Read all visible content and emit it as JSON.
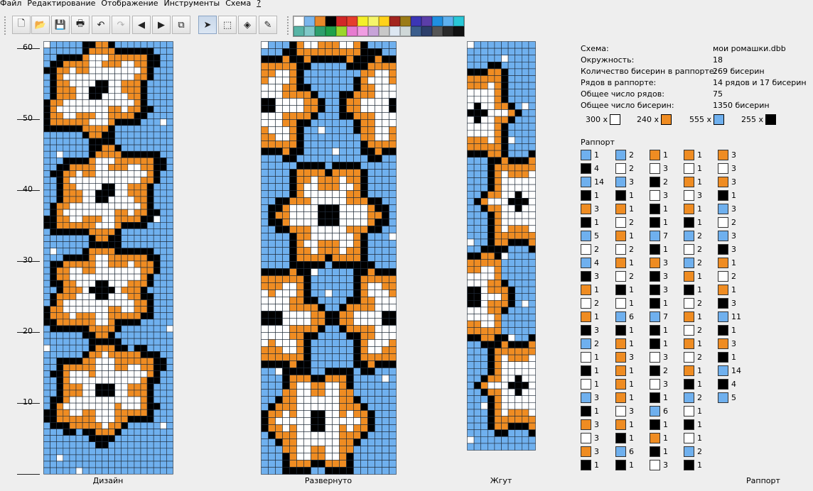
{
  "menu": [
    "Файл",
    "Редактирование",
    "Отображение",
    "Инструменты",
    "Схема",
    "?"
  ],
  "toolbar": {
    "buttons": [
      {
        "name": "new-file-button",
        "glyph": "🗋",
        "state": "normal"
      },
      {
        "name": "open-file-button",
        "glyph": "📂",
        "state": "normal"
      },
      {
        "name": "save-button",
        "glyph": "💾",
        "state": "normal"
      },
      {
        "name": "print-button",
        "glyph": "🖶",
        "state": "normal"
      },
      {
        "name": "undo-button",
        "glyph": "↶",
        "state": "normal"
      },
      {
        "name": "redo-button",
        "glyph": "↷",
        "state": "disabled"
      },
      {
        "name": "shift-left-button",
        "glyph": "◀",
        "state": "normal"
      },
      {
        "name": "shift-right-button",
        "glyph": "▶",
        "state": "normal"
      },
      {
        "name": "copy-button",
        "glyph": "⧉",
        "state": "normal"
      },
      {
        "name": "pointer-tool-button",
        "glyph": "➤",
        "state": "pressed"
      },
      {
        "name": "select-tool-button",
        "glyph": "⬚",
        "state": "normal"
      },
      {
        "name": "fill-tool-button",
        "glyph": "◈",
        "state": "normal"
      },
      {
        "name": "eyedropper-tool-button",
        "glyph": "✎",
        "state": "normal"
      }
    ],
    "palette_colors": [
      "#ffffff",
      "#7bb6ec",
      "#e8882a",
      "#000000",
      "#d12727",
      "#e53d2c",
      "#f4ef2a",
      "#f5f56a",
      "#ffd21a",
      "#a2251f",
      "#9b7b16",
      "#3c36b5",
      "#5b3ea8",
      "#1f8fe0",
      "#5eb1ef",
      "#29c7d7",
      "#58b4a6",
      "#7fc8c8",
      "#2e9f6d",
      "#1ea14b",
      "#9bd62c",
      "#e67ad0",
      "#f09ce2",
      "#c7a3d8",
      "#c8c8c8",
      "#dde7f2",
      "#cfd8d8",
      "#3a5d8c",
      "#2c3f6b",
      "#555555",
      "#2a2a2a",
      "#111111"
    ]
  },
  "ruler_labels": [
    "60",
    "50",
    "40",
    "30",
    "20",
    "10"
  ],
  "bead_colors": {
    "blue": "#6fb0ee",
    "orange": "#ef8c22",
    "white": "#ffffff",
    "black": "#000000"
  },
  "views": {
    "design_caption": "Дизайн",
    "unrolled_caption": "Развернуто",
    "rope_caption": "Жгут",
    "rapport_caption": "Раппорт"
  },
  "info": [
    {
      "label": "Схема:",
      "value": "мои ромашки.dbb"
    },
    {
      "label": "Окружность:",
      "value": "18"
    },
    {
      "label": "Количество бисерин в раппорте:",
      "value": "269 бисерин"
    },
    {
      "label": "Рядов в раппорте:",
      "value": "14 рядов и 17 бисерин"
    },
    {
      "label": "Общее число рядов:",
      "value": "75"
    },
    {
      "label": "Общее число бисерин:",
      "value": "1350 бисерин"
    }
  ],
  "counts": [
    {
      "text": "300 x",
      "color": "#ffffff"
    },
    {
      "text": "240 x",
      "color": "#ef8c22"
    },
    {
      "text": "555 x",
      "color": "#6fb0ee"
    },
    {
      "text": "255 x",
      "color": "#000000"
    }
  ],
  "rapport_title": "Раппорт",
  "rapport_columns": [
    [
      [
        "blue",
        "1"
      ],
      [
        "black",
        "4"
      ],
      [
        "blue",
        "14"
      ],
      [
        "black",
        "1"
      ],
      [
        "orange",
        "3"
      ],
      [
        "black",
        "1"
      ],
      [
        "blue",
        "5"
      ],
      [
        "white",
        "2"
      ],
      [
        "blue",
        "4"
      ],
      [
        "black",
        "3"
      ],
      [
        "orange",
        "1"
      ],
      [
        "white",
        "2"
      ],
      [
        "orange",
        "1"
      ],
      [
        "black",
        "3"
      ],
      [
        "blue",
        "2"
      ],
      [
        "white",
        "1"
      ],
      [
        "black",
        "1"
      ],
      [
        "white",
        "1"
      ],
      [
        "blue",
        "3"
      ],
      [
        "black",
        "1"
      ],
      [
        "orange",
        "3"
      ],
      [
        "white",
        "3"
      ],
      [
        "orange",
        "3"
      ],
      [
        "black",
        "1"
      ]
    ],
    [
      [
        "blue",
        "2"
      ],
      [
        "white",
        "2"
      ],
      [
        "blue",
        "3"
      ],
      [
        "black",
        "1"
      ],
      [
        "orange",
        "1"
      ],
      [
        "white",
        "2"
      ],
      [
        "orange",
        "1"
      ],
      [
        "white",
        "2"
      ],
      [
        "orange",
        "1"
      ],
      [
        "white",
        "2"
      ],
      [
        "black",
        "1"
      ],
      [
        "white",
        "1"
      ],
      [
        "blue",
        "6"
      ],
      [
        "black",
        "1"
      ],
      [
        "orange",
        "1"
      ],
      [
        "orange",
        "3"
      ],
      [
        "orange",
        "1"
      ],
      [
        "orange",
        "1"
      ],
      [
        "orange",
        "1"
      ],
      [
        "white",
        "3"
      ],
      [
        "orange",
        "1"
      ],
      [
        "black",
        "1"
      ],
      [
        "blue",
        "6"
      ],
      [
        "black",
        "1"
      ]
    ],
    [
      [
        "orange",
        "1"
      ],
      [
        "white",
        "3"
      ],
      [
        "black",
        "2"
      ],
      [
        "white",
        "3"
      ],
      [
        "black",
        "1"
      ],
      [
        "black",
        "1"
      ],
      [
        "blue",
        "7"
      ],
      [
        "black",
        "1"
      ],
      [
        "orange",
        "3"
      ],
      [
        "black",
        "3"
      ],
      [
        "black",
        "3"
      ],
      [
        "black",
        "1"
      ],
      [
        "blue",
        "7"
      ],
      [
        "black",
        "1"
      ],
      [
        "black",
        "1"
      ],
      [
        "white",
        "3"
      ],
      [
        "black",
        "2"
      ],
      [
        "white",
        "3"
      ],
      [
        "black",
        "1"
      ],
      [
        "blue",
        "6"
      ],
      [
        "black",
        "1"
      ],
      [
        "orange",
        "1"
      ],
      [
        "black",
        "1"
      ],
      [
        "white",
        "3"
      ]
    ],
    [
      [
        "orange",
        "1"
      ],
      [
        "white",
        "1"
      ],
      [
        "orange",
        "1"
      ],
      [
        "white",
        "3"
      ],
      [
        "orange",
        "1"
      ],
      [
        "black",
        "1"
      ],
      [
        "blue",
        "2"
      ],
      [
        "white",
        "2"
      ],
      [
        "blue",
        "2"
      ],
      [
        "orange",
        "1"
      ],
      [
        "black",
        "1"
      ],
      [
        "white",
        "2"
      ],
      [
        "orange",
        "1"
      ],
      [
        "white",
        "2"
      ],
      [
        "orange",
        "1"
      ],
      [
        "white",
        "2"
      ],
      [
        "orange",
        "1"
      ],
      [
        "black",
        "1"
      ],
      [
        "blue",
        "2"
      ],
      [
        "white",
        "1"
      ],
      [
        "black",
        "1"
      ],
      [
        "white",
        "1"
      ],
      [
        "blue",
        "2"
      ],
      [
        "black",
        "1"
      ]
    ],
    [
      [
        "orange",
        "3"
      ],
      [
        "white",
        "3"
      ],
      [
        "orange",
        "3"
      ],
      [
        "black",
        "1"
      ],
      [
        "blue",
        "3"
      ],
      [
        "white",
        "2"
      ],
      [
        "blue",
        "3"
      ],
      [
        "black",
        "3"
      ],
      [
        "orange",
        "1"
      ],
      [
        "white",
        "2"
      ],
      [
        "orange",
        "1"
      ],
      [
        "black",
        "3"
      ],
      [
        "blue",
        "11"
      ],
      [
        "black",
        "1"
      ],
      [
        "orange",
        "3"
      ],
      [
        "black",
        "1"
      ],
      [
        "blue",
        "14"
      ],
      [
        "black",
        "4"
      ],
      [
        "blue",
        "5"
      ]
    ]
  ]
}
